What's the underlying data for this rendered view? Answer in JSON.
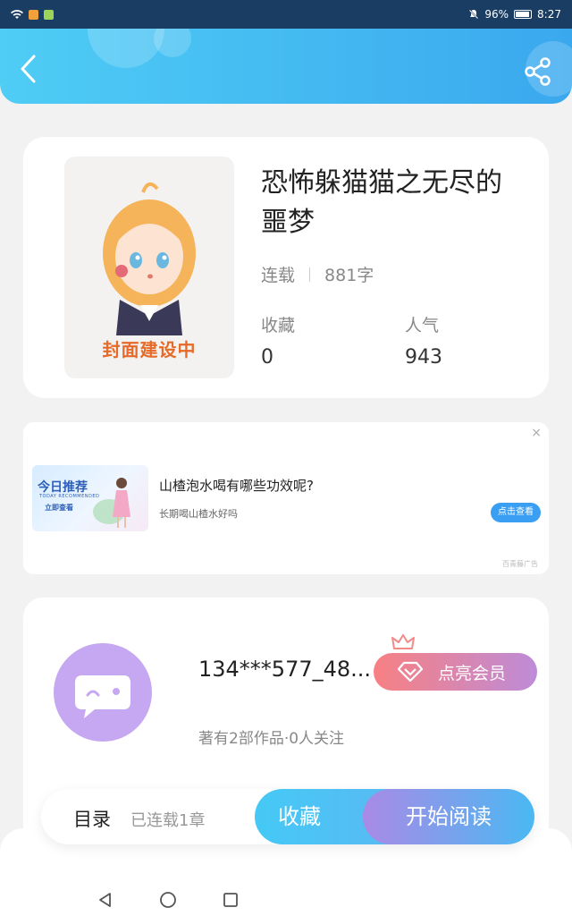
{
  "status_bar": {
    "battery": "96%",
    "time": "8:27"
  },
  "header": {
    "gradient_colors": [
      "#4fcdf5",
      "#3aa8ee"
    ]
  },
  "book": {
    "cover_text": "封面建设中",
    "title": "恐怖躲猫猫之无尽的噩梦",
    "status": "连载",
    "word_count": "881字",
    "stats": [
      {
        "label": "收藏",
        "value": "0"
      },
      {
        "label": "人气",
        "value": "943"
      }
    ]
  },
  "ad": {
    "image_title": "今日推荐",
    "image_subtitle": "TODAY RECOMMENDED",
    "image_button": "立即查看",
    "title": "山楂泡水喝有哪些功效呢?",
    "subtitle": "长期喝山楂水好吗",
    "button": "点击查看",
    "tag": "百青藤广告",
    "close": "×"
  },
  "author": {
    "name": "134***577_48...",
    "vip_button": "点亮会员",
    "stats": "著有2部作品·0人关注"
  },
  "bottom_bar": {
    "toc_label": "目录",
    "toc_sub": "已连载1章",
    "favorite_button": "收藏",
    "read_button": "开始阅读"
  },
  "nav_icons": [
    "back-triangle-icon",
    "home-circle-icon",
    "recents-square-icon"
  ]
}
